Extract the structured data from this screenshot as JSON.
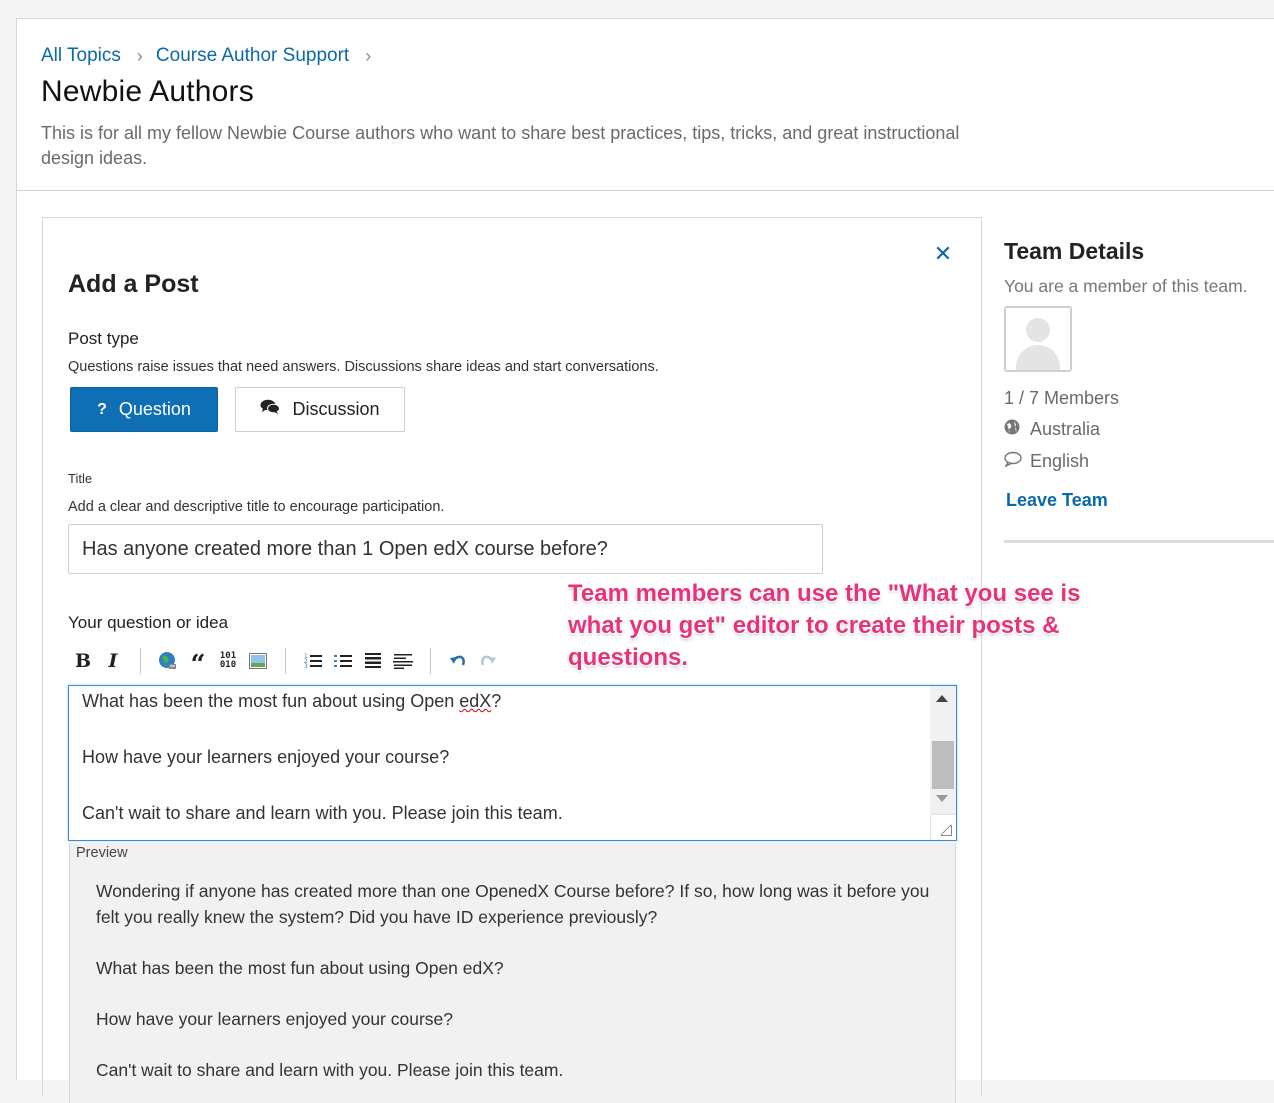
{
  "breadcrumb": {
    "items": [
      "All Topics",
      "Course Author Support"
    ],
    "separator": "›"
  },
  "page": {
    "title": "Newbie Authors",
    "description": "This is for all my fellow Newbie Course authors who want to share best practices, tips, tricks, and great instructional design ideas."
  },
  "post_form": {
    "heading": "Add a Post",
    "close_icon": "close-icon",
    "post_type_label": "Post type",
    "post_type_help": "Questions raise issues that need answers. Discussions share ideas and start conversations.",
    "question_label": "Question",
    "discussion_label": "Discussion",
    "title_label": "Title",
    "title_help": "Add a clear and descriptive title to encourage participation.",
    "title_value": "Has anyone created more than 1 Open edX course before?",
    "body_label": "Your question or idea",
    "toolbar_icons": [
      "bold-icon",
      "italic-icon",
      "link-icon",
      "blockquote-icon",
      "code-icon",
      "image-icon",
      "numbered-list-icon",
      "bulleted-list-icon",
      "heading-icon",
      "horizontal-rule-icon",
      "undo-icon",
      "redo-icon"
    ],
    "editor_lines": [
      "What has been the most fun about using Open edX?",
      "How have your learners enjoyed your course?",
      "Can't wait to share and learn with you. Please join this team."
    ],
    "editor_line1_prefix": "What has been the most fun about using Open ",
    "editor_line1_word": "edX",
    "editor_line1_suffix": "?",
    "preview_label": "Preview",
    "preview_paragraphs": [
      "Wondering if anyone has created more than one OpenedX Course before? If so, how long was it before you felt you really knew the system? Did you have ID experience previously?",
      "What has been the most fun about using Open edX?",
      "How have your learners enjoyed your course?",
      "Can't wait to share and learn with you. Please join this team."
    ]
  },
  "annotation": "Team members can use the \"What you see is what you get\" editor to create their posts & questions.",
  "team": {
    "title": "Team Details",
    "membership": "You are a member of this team.",
    "members": "1 / 7 Members",
    "country": "Australia",
    "language": "English",
    "leave_label": "Leave Team"
  },
  "colors": {
    "link": "#0a6aa8",
    "primary_button": "#0f6fb5",
    "annotation": "#e8327a"
  }
}
